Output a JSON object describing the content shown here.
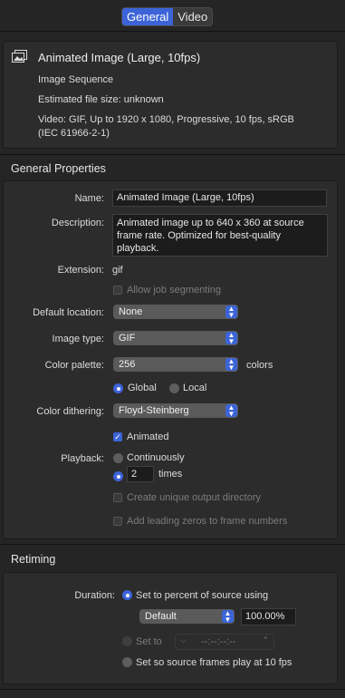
{
  "tabs": [
    {
      "label": "General"
    },
    {
      "label": "Video"
    }
  ],
  "summary": {
    "title": "Animated Image (Large, 10fps)",
    "type": "Image Sequence",
    "size": "Estimated file size: unknown",
    "video": "Video: GIF, Up to 1920 x 1080, Progressive, 10 fps, sRGB",
    "video2": "(IEC 61966-2-1)"
  },
  "general": {
    "header": "General Properties",
    "name_label": "Name:",
    "name_value": "Animated Image (Large, 10fps)",
    "desc_label": "Description:",
    "desc_value": "Animated image up to 640 x 360 at source frame rate. Optimized for best-quality playback.",
    "ext_label": "Extension:",
    "ext_value": "gif",
    "allow_seg": "Allow job segmenting",
    "loc_label": "Default location:",
    "loc_value": "None",
    "imgtype_label": "Image type:",
    "imgtype_value": "GIF",
    "palette_label": "Color palette:",
    "palette_value": "256",
    "palette_unit": "colors",
    "global": "Global",
    "local": "Local",
    "dither_label": "Color dithering:",
    "dither_value": "Floyd-Steinberg",
    "animated": "Animated",
    "playback_label": "Playback:",
    "continuously": "Continuously",
    "times_value": "2",
    "times": "times",
    "unique_dir": "Create unique output directory",
    "leading_zeros": "Add leading zeros to frame numbers"
  },
  "retiming": {
    "header": "Retiming",
    "duration_label": "Duration:",
    "set_percent": "Set to percent of source using",
    "mode_value": "Default",
    "percent_value": "100.00%",
    "set_to": "Set to",
    "timecode": "--:--:--:--",
    "set_source": "Set so source frames play at 10 fps"
  }
}
